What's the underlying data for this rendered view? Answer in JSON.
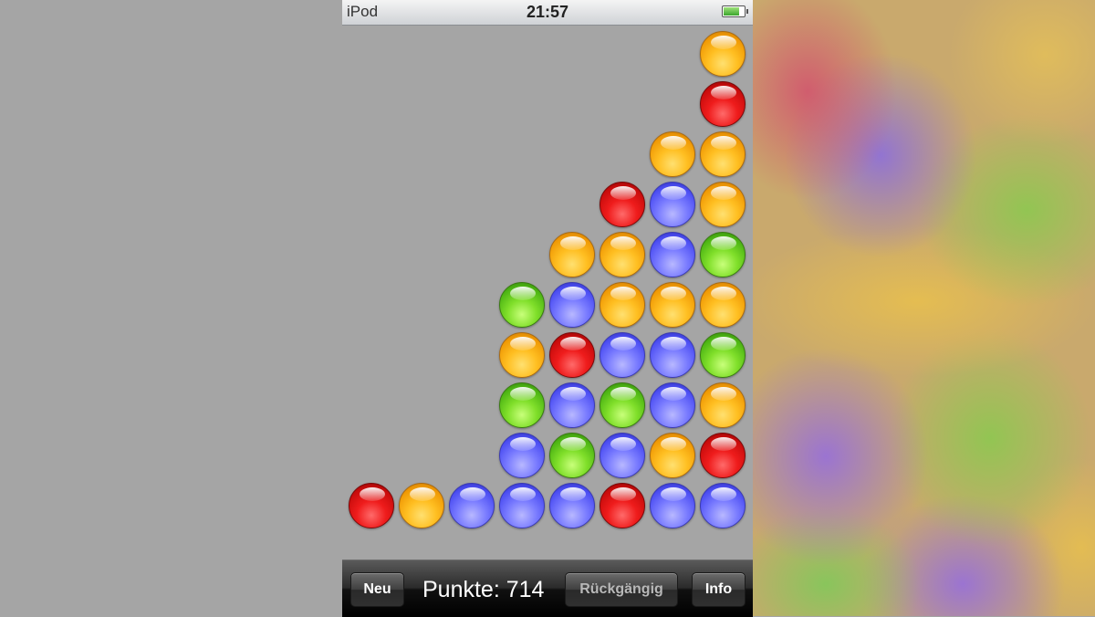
{
  "status_bar": {
    "device": "iPod",
    "time": "21:57",
    "battery_level": 0.75
  },
  "board": {
    "columns": 8,
    "rows": 10,
    "colors": {
      "orange": "#ffbf22",
      "red": "#ef1c1c",
      "blue": "#7a7cff",
      "green": "#80df2a"
    },
    "cells": [
      [
        null,
        null,
        null,
        null,
        null,
        null,
        null,
        "orange"
      ],
      [
        null,
        null,
        null,
        null,
        null,
        null,
        null,
        "red"
      ],
      [
        null,
        null,
        null,
        null,
        null,
        null,
        "orange",
        "orange"
      ],
      [
        null,
        null,
        null,
        null,
        null,
        "red",
        "blue",
        "orange"
      ],
      [
        null,
        null,
        null,
        null,
        "orange",
        "orange",
        "blue",
        "green"
      ],
      [
        null,
        null,
        null,
        "green",
        "blue",
        "orange",
        "orange",
        "orange"
      ],
      [
        null,
        null,
        null,
        "orange",
        "red",
        "blue",
        "blue",
        "green"
      ],
      [
        null,
        null,
        null,
        "green",
        "blue",
        "green",
        "blue",
        "orange"
      ],
      [
        null,
        null,
        null,
        "blue",
        "green",
        "blue",
        "orange",
        "red"
      ],
      [
        "red",
        "orange",
        "blue",
        "blue",
        "blue",
        "red",
        "blue",
        "blue"
      ]
    ]
  },
  "toolbar": {
    "new_label": "Neu",
    "score_text": "Punkte: 714",
    "undo_label": "Rückgängig",
    "info_label": "Info"
  },
  "icons": {
    "battery": "battery-icon"
  }
}
